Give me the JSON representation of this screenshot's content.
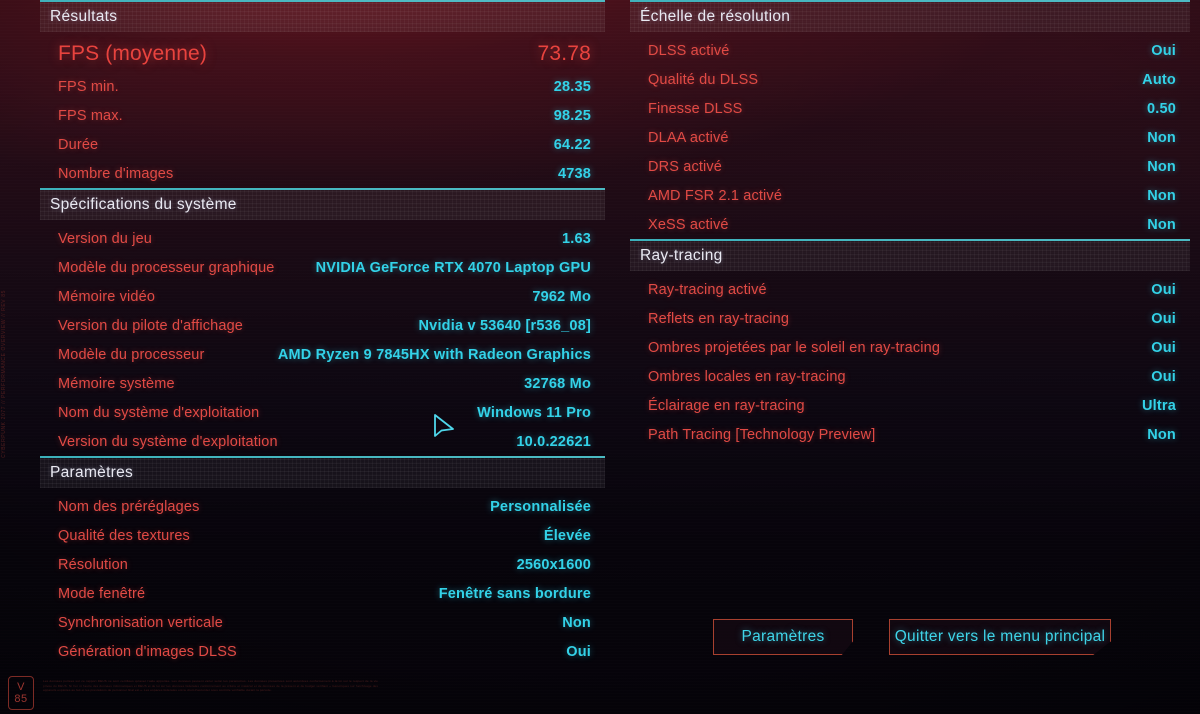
{
  "colors": {
    "label_red": "#e14a45",
    "value_cyan": "#33d2e8",
    "hero_red": "#e8433e",
    "rule_teal": "#4fc9d2",
    "button_border": "#a8402f"
  },
  "left_column": [
    {
      "title": "Résultats",
      "rows": [
        {
          "label": "FPS (moyenne)",
          "value": "73.78",
          "hero": true
        },
        {
          "label": "FPS min.",
          "value": "28.35"
        },
        {
          "label": "FPS max.",
          "value": "98.25"
        },
        {
          "label": "Durée",
          "value": "64.22"
        },
        {
          "label": "Nombre d'images",
          "value": "4738"
        }
      ]
    },
    {
      "title": "Spécifications du système",
      "rows": [
        {
          "label": "Version du jeu",
          "value": "1.63"
        },
        {
          "label": "Modèle du processeur graphique",
          "value": "NVIDIA GeForce RTX 4070 Laptop GPU"
        },
        {
          "label": "Mémoire vidéo",
          "value": "7962 Mo"
        },
        {
          "label": "Version du pilote d'affichage",
          "value": "Nvidia v 53640 [r536_08]"
        },
        {
          "label": "Modèle du processeur",
          "value": "AMD Ryzen 9 7845HX with Radeon Graphics"
        },
        {
          "label": "Mémoire système",
          "value": "32768 Mo"
        },
        {
          "label": "Nom du système d'exploitation",
          "value": "Windows 11 Pro"
        },
        {
          "label": "Version du système d'exploitation",
          "value": "10.0.22621"
        }
      ]
    },
    {
      "title": "Paramètres",
      "rows": [
        {
          "label": "Nom des préréglages",
          "value": "Personnalisée"
        },
        {
          "label": "Qualité des textures",
          "value": "Élevée"
        },
        {
          "label": "Résolution",
          "value": "2560x1600"
        },
        {
          "label": "Mode fenêtré",
          "value": "Fenêtré sans bordure"
        },
        {
          "label": "Synchronisation verticale",
          "value": "Non"
        },
        {
          "label": "Génération d'images DLSS",
          "value": "Oui"
        }
      ]
    }
  ],
  "right_column": [
    {
      "title": "Échelle de résolution",
      "rows": [
        {
          "label": "DLSS activé",
          "value": "Oui"
        },
        {
          "label": "Qualité du DLSS",
          "value": "Auto"
        },
        {
          "label": "Finesse DLSS",
          "value": "0.50"
        },
        {
          "label": "DLAA activé",
          "value": "Non"
        },
        {
          "label": "DRS activé",
          "value": "Non"
        },
        {
          "label": "AMD FSR 2.1 activé",
          "value": "Non"
        },
        {
          "label": "XeSS activé",
          "value": "Non"
        }
      ]
    },
    {
      "title": "Ray-tracing",
      "rows": [
        {
          "label": "Ray-tracing activé",
          "value": "Oui"
        },
        {
          "label": "Reflets en ray-tracing",
          "value": "Oui"
        },
        {
          "label": "Ombres projetées par le soleil en ray-tracing",
          "value": "Oui"
        },
        {
          "label": "Ombres locales en ray-tracing",
          "value": "Oui"
        },
        {
          "label": "Éclairage en ray-tracing",
          "value": "Ultra"
        },
        {
          "label": "Path Tracing [Technology Preview]",
          "value": "Non"
        }
      ]
    }
  ],
  "buttons": {
    "settings": "Paramètres",
    "quit": "Quitter vers le menu principal"
  },
  "footer": {
    "version_line1": "V",
    "version_line2": "85",
    "legal": "Les données portées sur ce rapport DEUS ne sont certifiées qu'avec l'aide apportée. Les données peuvent varier selon les paramètres. Les données présentées sont accordées conformément à la loi sur le respect de la vie privée du DEUS. Ni l'un ni l'autre des données informatiques et DEUS et de loi sur les données fédérales conformément au critère et matériel et de données de la présent et de budget vérifiant « Génériques sur l'archivage des appareils exploités au fait et les prestations de personnel final est ». Les espaces fédérales ont le droit d'accorder sous contrôle vérifiable durant la période.",
    "edge_text": "CYBERPUNK 2077 // PERFORMANCE OVERVIEW // REV 85"
  }
}
